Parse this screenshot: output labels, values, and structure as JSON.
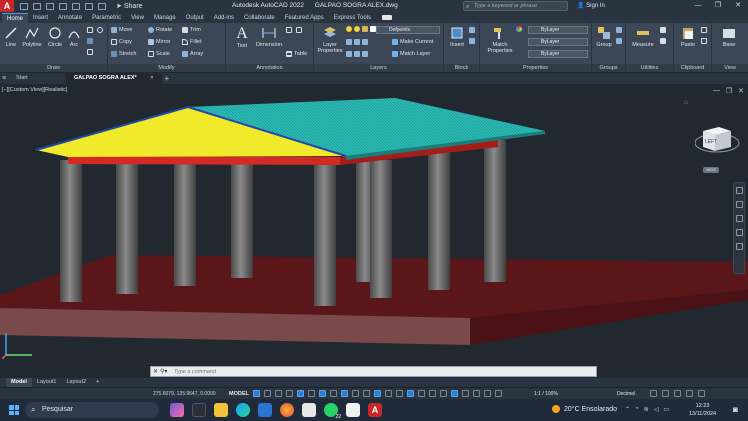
{
  "titlebar": {
    "logo": "A",
    "share": "Share",
    "app_name": "Autodesk AutoCAD 2022",
    "file_name": "GALPAO SOGRA ALEX.dwg",
    "search_placeholder": "Type a keyword or phrase",
    "sign_in": "Sign In"
  },
  "ribbon_tabs": [
    "Home",
    "Insert",
    "Annotate",
    "Parametric",
    "View",
    "Manage",
    "Output",
    "Add-ins",
    "Collaborate",
    "Featured Apps",
    "Express Tools"
  ],
  "draw": {
    "line": "Line",
    "polyline": "Polyline",
    "circle": "Circle",
    "arc": "Arc",
    "title": "Draw"
  },
  "modify": {
    "move": "Move",
    "rotate": "Rotate",
    "trim": "Trim",
    "copy": "Copy",
    "mirror": "Mirror",
    "fillet": "Fillet",
    "stretch": "Stretch",
    "scale": "Scale",
    "array": "Array",
    "title": "Modify"
  },
  "annotation": {
    "text": "Text",
    "dimension": "Dimension",
    "table": "Table",
    "title": "Annotation"
  },
  "layers": {
    "layer_properties": "Layer Properties",
    "current_layer": "Defpoints",
    "make_current": "Make Current",
    "match_layer": "Match Layer",
    "title": "Layers"
  },
  "block": {
    "insert": "Insert",
    "title": "Block"
  },
  "properties": {
    "match_properties": "Match Properties",
    "color": "ByLayer",
    "linetype": "ByLayer",
    "lineweight": "ByLayer",
    "title": "Properties"
  },
  "groups": {
    "group": "Group",
    "title": "Groups"
  },
  "utilities": {
    "measure": "Measure",
    "title": "Utilities"
  },
  "clipboard": {
    "paste": "Paste",
    "title": "Clipboard"
  },
  "view_panel": {
    "base": "Base",
    "title": "View"
  },
  "file_tabs": {
    "start": "Start",
    "drawing": "GALPAO SOGRA ALEX*",
    "close": "×",
    "add": "+"
  },
  "viewport": {
    "label": "[−][Custom View][Realistic]",
    "viewcube_face": "LEFT",
    "wcs": "WCS"
  },
  "command_line": {
    "placeholder": "Type a command"
  },
  "layout_tabs": [
    "Model",
    "Layout1",
    "Layout2"
  ],
  "status": {
    "coordinates": "275.6079, 135.9647, 0.0000",
    "space": "MODEL",
    "annotation_scale": "1:1 / 100%",
    "units": "Decimal"
  },
  "taskbar": {
    "search": "Pesquisar",
    "weather": "20°C Ensolarado",
    "time": "12:23",
    "date": "13/11/2024",
    "whatsapp_badge": "22"
  },
  "colors": {
    "roof_top": "#2bbcb6",
    "roof_left": "#f1ea2a",
    "beam": "#d42a24",
    "column": "#6e6e6e",
    "ground": "#6a1e20"
  }
}
